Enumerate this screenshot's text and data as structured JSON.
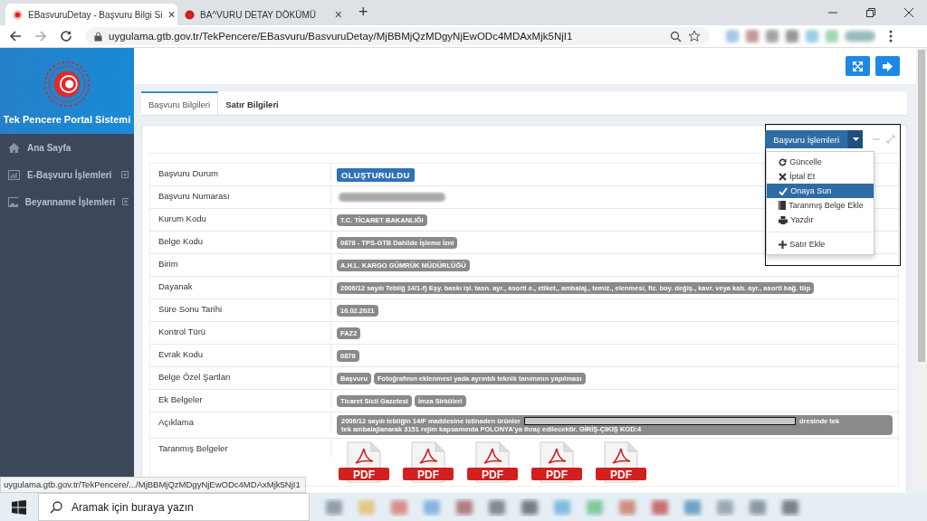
{
  "browser": {
    "tabs": [
      {
        "title": "EBasvuruDetay - Başvuru Bilgi Si",
        "selected": true,
        "close": "×"
      },
      {
        "title": "BA^VURU DETAY DÖKÜMÜ",
        "selected": false,
        "close": "×"
      }
    ],
    "new_tab": "+",
    "url": "uygulama.gtb.gov.tr/TekPencere/EBasvuru/BasvuruDetay/MjBBMjQzMDgyNjEwODc4MDAxMjk5NjI1"
  },
  "sidebar": {
    "title": "Tek Pencere Portal Sistemi",
    "items": [
      {
        "label": "Ana Sayfa",
        "expandable": false
      },
      {
        "label": "E-Başvuru İşlemleri",
        "expandable": true
      },
      {
        "label": "Beyanname İşlemleri",
        "expandable": true
      }
    ]
  },
  "tabs": [
    {
      "label": "Başvuru Bilgileri",
      "selected": true
    },
    {
      "label": "Satır Bilgileri",
      "selected": false
    }
  ],
  "actions": {
    "label": "Başvuru İşlemleri",
    "expanded": true,
    "menu": [
      {
        "label": "Güncelle",
        "selected": false
      },
      {
        "label": "İptal Et",
        "selected": false
      },
      {
        "label": "Onaya Sun",
        "selected": true
      },
      {
        "label": "Taranmış Belge Ekle",
        "selected": false
      },
      {
        "label": "Yazdır",
        "selected": false
      },
      {
        "label": "Satır Ekle",
        "selected": false
      }
    ]
  },
  "details": [
    {
      "label": "Başvuru Durum",
      "values": [
        {
          "kind": "status",
          "text": "OLUŞTURULDU"
        }
      ]
    },
    {
      "label": "Başvuru Numarası",
      "values": [
        {
          "kind": "blurred"
        }
      ]
    },
    {
      "label": "Kurum Kodu",
      "values": [
        {
          "kind": "tag",
          "text": "T.C. TİCARET BAKANLIĞI"
        }
      ]
    },
    {
      "label": "Belge Kodu",
      "values": [
        {
          "kind": "tag",
          "text": "0878 - TPS-GTB Dahilde İşleme İzni"
        }
      ]
    },
    {
      "label": "Birim",
      "values": [
        {
          "kind": "tag",
          "text": "A.H.L. KARGO GÜMRÜK MÜDÜRLÜĞÜ"
        }
      ]
    },
    {
      "label": "Dayanak",
      "values": [
        {
          "kind": "tag",
          "text": "2006/12 sayılı Tebliğ 14/1-f) Eşy. baskı işl. tasn. ayr., asorti e., etiket., ambalaj., temiz., elenmesi, fiz. boy. değiş., kavr. veya kab. ayr., asorti bağ. tüp"
        }
      ]
    },
    {
      "label": "Süre Sonu Tarihi",
      "values": [
        {
          "kind": "tag",
          "text": "16.02.2021"
        }
      ]
    },
    {
      "label": "Kontrol Türü",
      "values": [
        {
          "kind": "tag",
          "text": "FAZ2"
        }
      ]
    },
    {
      "label": "Evrak Kodu",
      "values": [
        {
          "kind": "tag",
          "text": "0878"
        }
      ]
    },
    {
      "label": "Belge Özel Şartları",
      "values": [
        {
          "kind": "tag",
          "text": "Başvuru"
        },
        {
          "kind": "tag",
          "text": "Fotoğrafının eklenmesi yada ayrıntılı teknik tanımının yapılması"
        }
      ]
    },
    {
      "label": "Ek Belgeler",
      "values": [
        {
          "kind": "tag",
          "text": "Ticaret Sicil Gazetesi"
        },
        {
          "kind": "tag",
          "text": "İmza Sirküleri"
        }
      ]
    },
    {
      "label": "Açıklama",
      "values": [
        {
          "kind": "note",
          "parts": [
            "2006/12 sayılı tebliğin 14/F  maddesine istinaden ürünler",
            "dresinde  tek",
            "tek ambalajlanarak  3151 rejim kapsamında  POLONYA'ya ihraç edilecektir. GİRİŞ-ÇIKIŞ KOD:4"
          ]
        }
      ]
    },
    {
      "label": "Taranmış Belgeler",
      "values": [
        {
          "kind": "pdf",
          "text": "PDF"
        },
        {
          "kind": "pdf",
          "text": "PDF"
        },
        {
          "kind": "pdf",
          "text": "PDF"
        },
        {
          "kind": "pdf",
          "text": "PDF"
        },
        {
          "kind": "pdf",
          "text": "PDF"
        }
      ]
    }
  ],
  "status_url": "uygulama.gtb.gov.tr/TekPencere/.../MjBBMjQzMDgyNjEwODc4MDAxMjk5NjI1",
  "taskbar": {
    "search_placeholder": "Aramak için buraya yazın"
  }
}
